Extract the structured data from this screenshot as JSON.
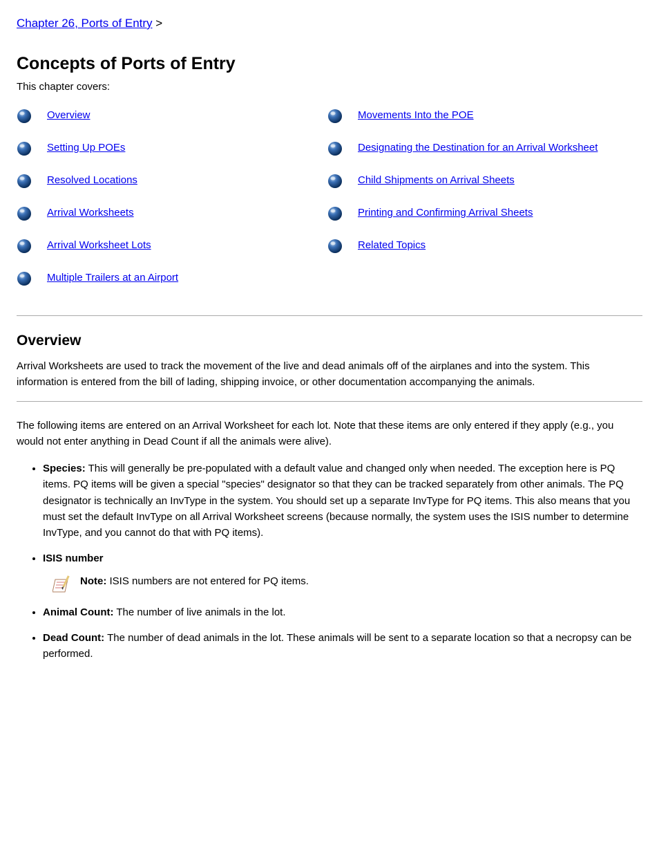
{
  "breadcrumb": {
    "link": "Chapter 26, Ports of Entry",
    "sep": " > "
  },
  "title": "Concepts of Ports of Entry",
  "intro": "This chapter covers:",
  "linksLeft": [
    "Overview",
    "Setting Up POEs",
    "Resolved Locations",
    "Arrival Worksheets",
    "Arrival Worksheet Lots",
    "Multiple Trailers at an Airport"
  ],
  "linksRight": [
    "Movements Into the POE",
    "Designating the Destination for an Arrival Worksheet",
    "Child Shipments on Arrival Sheets",
    "Printing and Confirming Arrival Sheets",
    "Related Topics"
  ],
  "overview": {
    "heading": "Overview",
    "p1": "Arrival Worksheets are used to track the movement of the live and dead animals off of the airplanes and into the system. This information is entered from the bill of lading, shipping invoice, or other documentation accompanying the animals.",
    "p2": "The following items are entered on an Arrival Worksheet for each lot. Note that these items are only entered if they apply (e.g., you would not enter anything in Dead Count if all the animals were alive)."
  },
  "list": {
    "item1": {
      "title": "Species:",
      "text": " This will generally be pre-populated with a default value and changed only when needed. The exception here is PQ items. PQ items will be given a special \"species\" designator so that they can be tracked separately from other animals. The PQ designator is technically an InvType in the system. You should set up a separate InvType for PQ items. This also means that you must set the default InvType on all Arrival Worksheet screens (because normally, the system uses the ISIS number to determine InvType, and you cannot do that with PQ items)."
    },
    "item2": {
      "title": "ISIS number",
      "note": {
        "label": "Note:",
        "text": " ISIS numbers are not entered for PQ items."
      }
    },
    "item3": {
      "title": "Animal Count:",
      "text": " The number of live animals in the lot."
    },
    "item4": {
      "title": "Dead Count:",
      "text": " The number of dead animals in the lot. These animals will be sent to a separate location so that a necropsy can be performed."
    }
  }
}
